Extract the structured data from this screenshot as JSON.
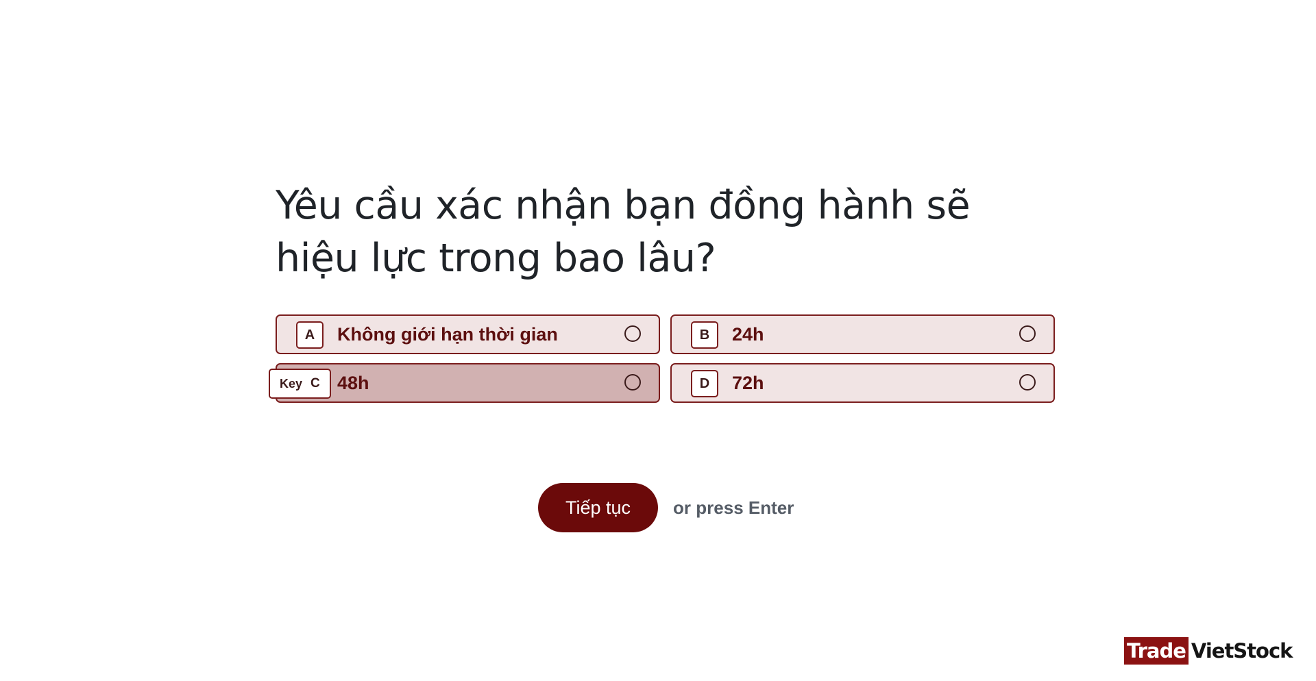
{
  "question": {
    "text": "Yêu cầu xác nhận bạn đồng hành sẽ hiệu lực trong bao lâu?"
  },
  "options": [
    {
      "key": "A",
      "label": "Không giới hạn thời gian"
    },
    {
      "key": "B",
      "label": "24h"
    },
    {
      "key": "C",
      "label": "48h",
      "hint_word": "Key"
    },
    {
      "key": "D",
      "label": "72h"
    }
  ],
  "actions": {
    "continue_label": "Tiếp tục",
    "press_hint": "or press Enter"
  },
  "brand": {
    "left": "Trade",
    "right": "VietStock"
  },
  "colors": {
    "accent": "#6b0a0a",
    "option_bg": "#f1e4e4",
    "option_hover_bg": "#d1b1b1",
    "brand_red": "#8b1212"
  }
}
